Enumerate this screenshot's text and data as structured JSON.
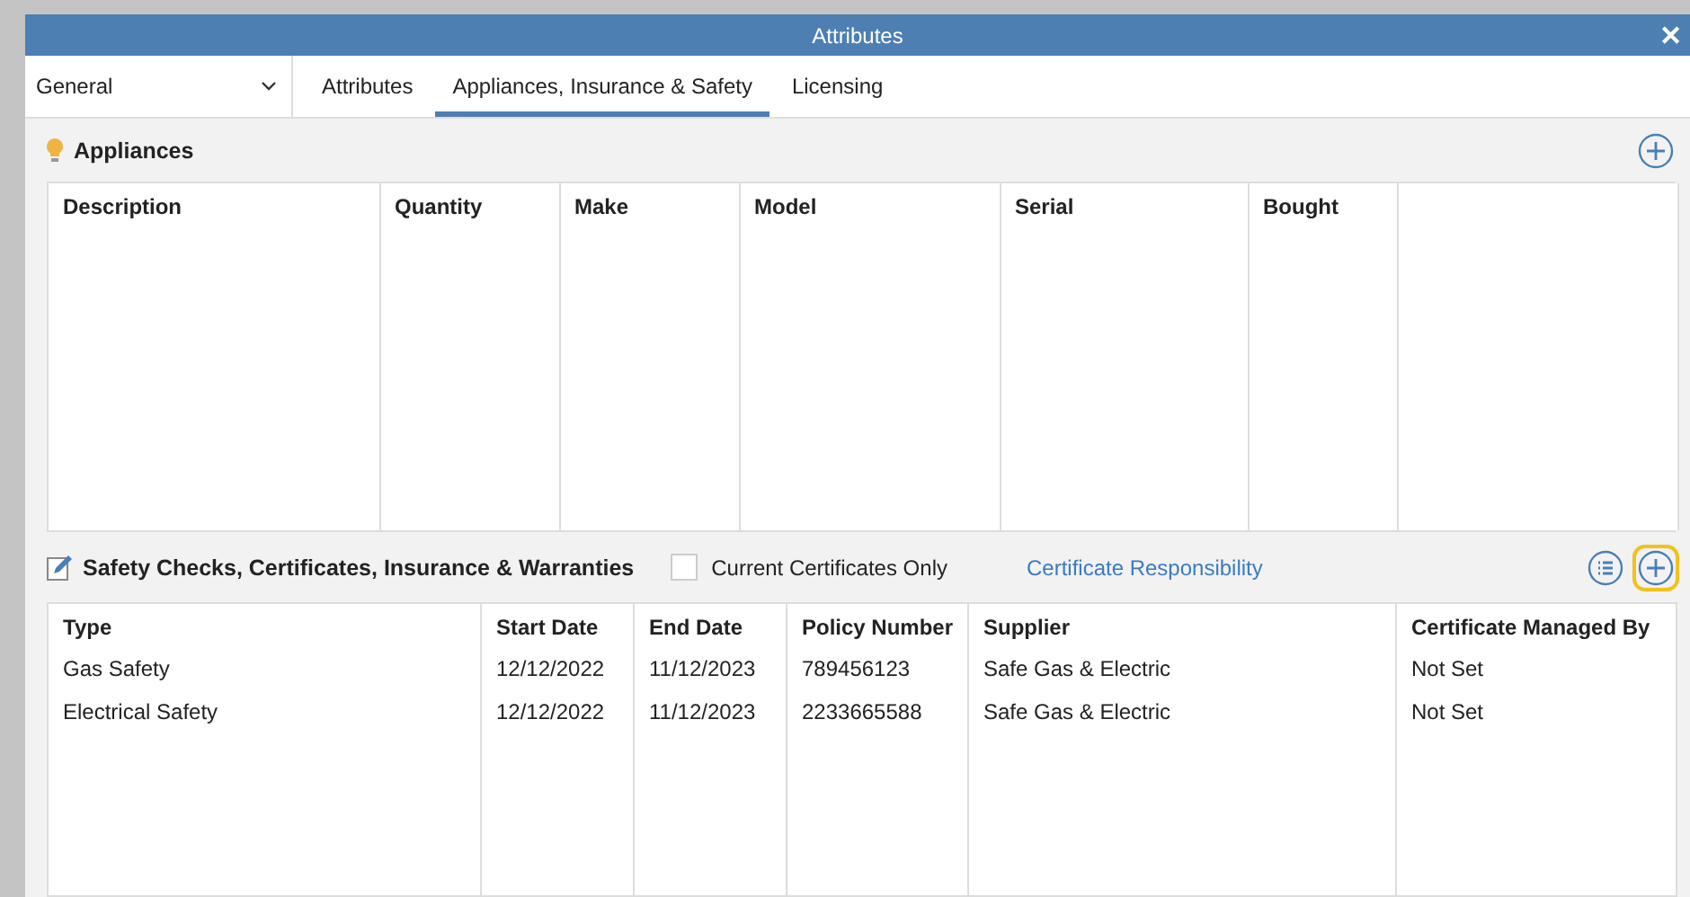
{
  "window": {
    "title": "Attributes",
    "close": "✕"
  },
  "category_dropdown": {
    "value": "General"
  },
  "tabs": [
    {
      "label": "Attributes",
      "selected": false
    },
    {
      "label": "Appliances, Insurance & Safety",
      "selected": true
    },
    {
      "label": "Licensing",
      "selected": false
    }
  ],
  "appliances": {
    "title": "Appliances",
    "add_highlighted": false,
    "columns": [
      "Description",
      "Quantity",
      "Make",
      "Model",
      "Serial",
      "Bought",
      ""
    ]
  },
  "safety": {
    "title": "Safety Checks, Certificates, Insurance & Warranties",
    "current_only": {
      "label": "Current Certificates Only",
      "checked": false
    },
    "link": "Certificate Responsibility",
    "add_highlighted": true,
    "columns": [
      "Type",
      "Start Date",
      "End Date",
      "Policy Number",
      "Supplier",
      "Certificate Managed By"
    ],
    "rows": [
      [
        "Gas Safety",
        "12/12/2022",
        "11/12/2023",
        "789456123",
        "Safe Gas & Electric",
        "Not Set"
      ],
      [
        "Electrical Safety",
        "12/12/2022",
        "11/12/2023",
        "2233665588",
        "Safe Gas & Electric",
        "Not Set"
      ]
    ]
  }
}
